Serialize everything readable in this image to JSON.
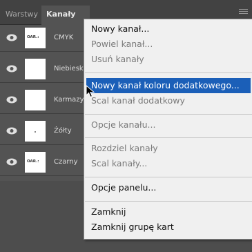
{
  "tabs": [
    "Warstwy",
    "Kanały"
  ],
  "channels": [
    {
      "label": "CMYK",
      "thumb": "logo"
    },
    {
      "label": "Niebieski",
      "thumb": "blank"
    },
    {
      "label": "Karmazyn",
      "thumb": "blank"
    },
    {
      "label": "Żółty",
      "thumb": "dot"
    },
    {
      "label": "Czarny",
      "thumb": "logo"
    }
  ],
  "thumb_logo_text": "OAR.:",
  "menu": {
    "items": [
      {
        "label": "Nowy kanał...",
        "enabled": true
      },
      {
        "label": "Powiel kanał...",
        "enabled": false
      },
      {
        "label": "Usuń kanały",
        "enabled": false
      },
      {
        "label": "Nowy kanał koloru dodatkowego...",
        "enabled": true,
        "highlighted": true
      },
      {
        "label": "Scal kanał dodatkowy",
        "enabled": false
      },
      {
        "label": "Opcje kanału...",
        "enabled": false
      },
      {
        "label": "Rozdziel kanały",
        "enabled": false
      },
      {
        "label": "Scal kanały...",
        "enabled": false
      },
      {
        "label": "Opcje panelu...",
        "enabled": true
      },
      {
        "label": "Zamknij",
        "enabled": true
      },
      {
        "label": "Zamknij grupę kart",
        "enabled": true
      }
    ]
  },
  "colors": {
    "panel_bg": "#535353",
    "menu_bg": "#f0f0f0",
    "highlight": "#1b5fb8"
  }
}
